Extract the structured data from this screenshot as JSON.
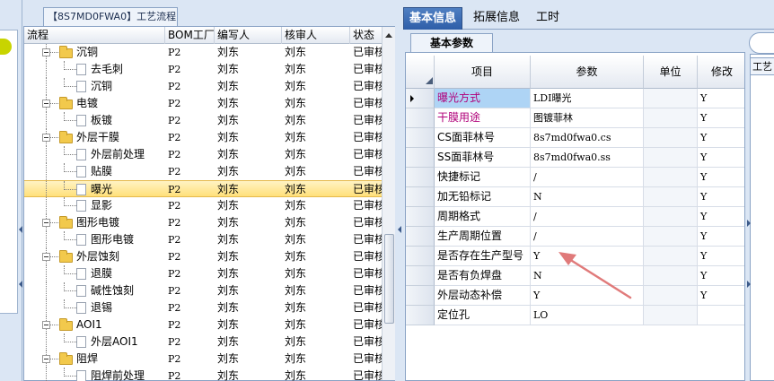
{
  "process_panel": {
    "title": "【8S7MD0FWA0】工艺流程",
    "columns": [
      "流程",
      "BOM工厂",
      "编写人",
      "核审人",
      "状态"
    ],
    "rows": [
      {
        "name": "沉铜",
        "level": 1,
        "kind": "folder",
        "bom": "P2",
        "writer": "刘东",
        "reviewer": "刘东",
        "status": "已审核"
      },
      {
        "name": "去毛刺",
        "level": 2,
        "kind": "doc",
        "bom": "P2",
        "writer": "刘东",
        "reviewer": "刘东",
        "status": "已审核"
      },
      {
        "name": "沉铜",
        "level": 2,
        "kind": "doc",
        "bom": "P2",
        "writer": "刘东",
        "reviewer": "刘东",
        "status": "已审核"
      },
      {
        "name": "电镀",
        "level": 1,
        "kind": "folder",
        "bom": "P2",
        "writer": "刘东",
        "reviewer": "刘东",
        "status": "已审核"
      },
      {
        "name": "板镀",
        "level": 2,
        "kind": "doc",
        "bom": "P2",
        "writer": "刘东",
        "reviewer": "刘东",
        "status": "已审核"
      },
      {
        "name": "外层干膜",
        "level": 1,
        "kind": "folder",
        "bom": "P2",
        "writer": "刘东",
        "reviewer": "刘东",
        "status": "已审核"
      },
      {
        "name": "外层前处理",
        "level": 2,
        "kind": "doc",
        "bom": "P2",
        "writer": "刘东",
        "reviewer": "刘东",
        "status": "已审核"
      },
      {
        "name": "贴膜",
        "level": 2,
        "kind": "doc",
        "bom": "P2",
        "writer": "刘东",
        "reviewer": "刘东",
        "status": "已审核"
      },
      {
        "name": "曝光",
        "level": 2,
        "kind": "doc",
        "bom": "P2",
        "writer": "刘东",
        "reviewer": "刘东",
        "status": "已审核",
        "selected": true
      },
      {
        "name": "显影",
        "level": 2,
        "kind": "doc",
        "bom": "P2",
        "writer": "刘东",
        "reviewer": "刘东",
        "status": "已审核"
      },
      {
        "name": "图形电镀",
        "level": 1,
        "kind": "folder",
        "bom": "P2",
        "writer": "刘东",
        "reviewer": "刘东",
        "status": "已审核"
      },
      {
        "name": "图形电镀",
        "level": 2,
        "kind": "doc",
        "bom": "P2",
        "writer": "刘东",
        "reviewer": "刘东",
        "status": "已审核"
      },
      {
        "name": "外层蚀刻",
        "level": 1,
        "kind": "folder",
        "bom": "P2",
        "writer": "刘东",
        "reviewer": "刘东",
        "status": "已审核"
      },
      {
        "name": "退膜",
        "level": 2,
        "kind": "doc",
        "bom": "P2",
        "writer": "刘东",
        "reviewer": "刘东",
        "status": "已审核"
      },
      {
        "name": "碱性蚀刻",
        "level": 2,
        "kind": "doc",
        "bom": "P2",
        "writer": "刘东",
        "reviewer": "刘东",
        "status": "已审核"
      },
      {
        "name": "退锡",
        "level": 2,
        "kind": "doc",
        "bom": "P2",
        "writer": "刘东",
        "reviewer": "刘东",
        "status": "已审核"
      },
      {
        "name": "AOI1",
        "level": 1,
        "kind": "folder",
        "bom": "P2",
        "writer": "刘东",
        "reviewer": "刘东",
        "status": "已审核"
      },
      {
        "name": "外层AOI1",
        "level": 2,
        "kind": "doc",
        "bom": "P2",
        "writer": "刘东",
        "reviewer": "刘东",
        "status": "已审核"
      },
      {
        "name": "阻焊",
        "level": 1,
        "kind": "folder",
        "bom": "P2",
        "writer": "刘东",
        "reviewer": "刘东",
        "status": "已审核"
      },
      {
        "name": "阻焊前处理",
        "level": 2,
        "kind": "doc",
        "bom": "P2",
        "writer": "刘东",
        "reviewer": "刘东",
        "status": "已审核"
      }
    ]
  },
  "main_tabs": [
    "基本信息",
    "拓展信息",
    "工时"
  ],
  "sub_tab": "基本参数",
  "param_grid": {
    "columns": [
      "项目",
      "参数",
      "单位",
      "修改"
    ],
    "rows": [
      {
        "item": "曝光方式",
        "value": "LDI曝光",
        "unit": "",
        "modify": "Y",
        "item_color": "#b0007a",
        "current": true
      },
      {
        "item": "干膜用途",
        "value": "图镀菲林",
        "unit": "",
        "modify": "Y",
        "item_color": "#b0007a"
      },
      {
        "item": "CS面菲林号",
        "value": "8s7md0fwa0.cs",
        "unit": "",
        "modify": "Y",
        "item_color": "#000000"
      },
      {
        "item": "SS面菲林号",
        "value": "8s7md0fwa0.ss",
        "unit": "",
        "modify": "Y",
        "item_color": "#000000"
      },
      {
        "item": "快捷标记",
        "value": "/",
        "unit": "",
        "modify": "Y",
        "item_color": "#000000"
      },
      {
        "item": "加无铅标记",
        "value": "N",
        "unit": "",
        "modify": "Y",
        "item_color": "#000000"
      },
      {
        "item": "周期格式",
        "value": "/",
        "unit": "",
        "modify": "Y",
        "item_color": "#000000"
      },
      {
        "item": "生产周期位置",
        "value": "/",
        "unit": "",
        "modify": "Y",
        "item_color": "#000000"
      },
      {
        "item": "是否存在生产型号",
        "value": "Y",
        "unit": "",
        "modify": "Y",
        "item_color": "#000000"
      },
      {
        "item": "是否有负焊盘",
        "value": "N",
        "unit": "",
        "modify": "Y",
        "item_color": "#000000"
      },
      {
        "item": "外层动态补偿",
        "value": "Y",
        "unit": "",
        "modify": "Y",
        "item_color": "#000000"
      },
      {
        "item": "定位孔",
        "value": "LO",
        "unit": "",
        "modify": "",
        "item_color": "#000000"
      }
    ]
  },
  "right_panel_tab": "工艺",
  "colors": {
    "accent_tab": "#2e5ea8",
    "selection": "#ffe07a",
    "current_cell": "#aed4f5",
    "annotation_arrow": "#e07a7a"
  }
}
